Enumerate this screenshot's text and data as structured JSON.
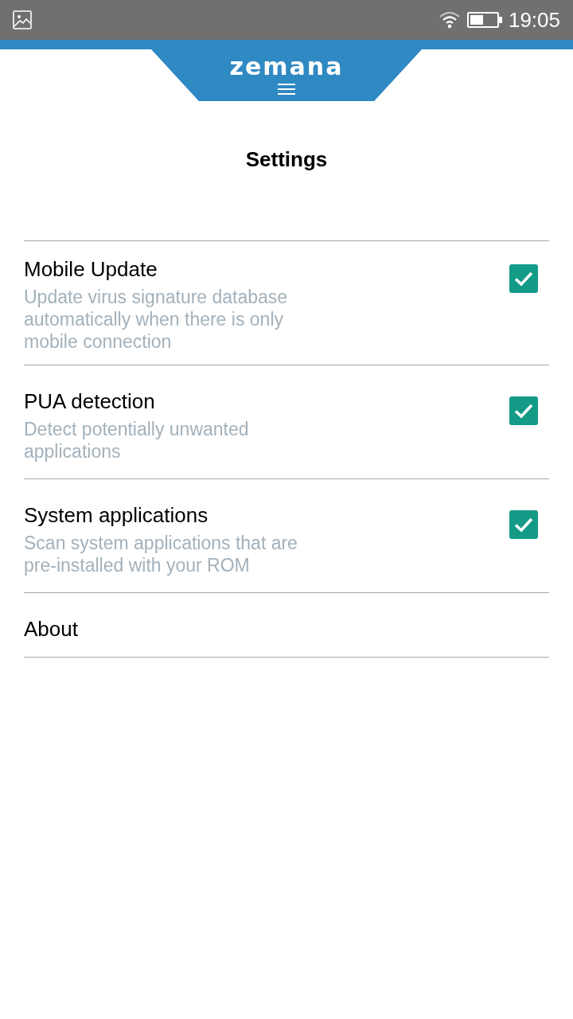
{
  "status_bar": {
    "time": "19:05"
  },
  "header": {
    "logo": "zemana"
  },
  "title": "Settings",
  "settings": [
    {
      "kind": "checkbox",
      "label": "Mobile Update",
      "description": "Update virus signature database automatically when there is only mobile connection",
      "checked": true
    },
    {
      "kind": "checkbox",
      "label": "PUA detection",
      "description": "Detect potentially unwanted applications",
      "checked": true
    },
    {
      "kind": "checkbox",
      "label": "System applications",
      "description": "Scan system applications that are pre-installed with your ROM",
      "checked": true
    },
    {
      "kind": "link",
      "label": "About"
    }
  ]
}
